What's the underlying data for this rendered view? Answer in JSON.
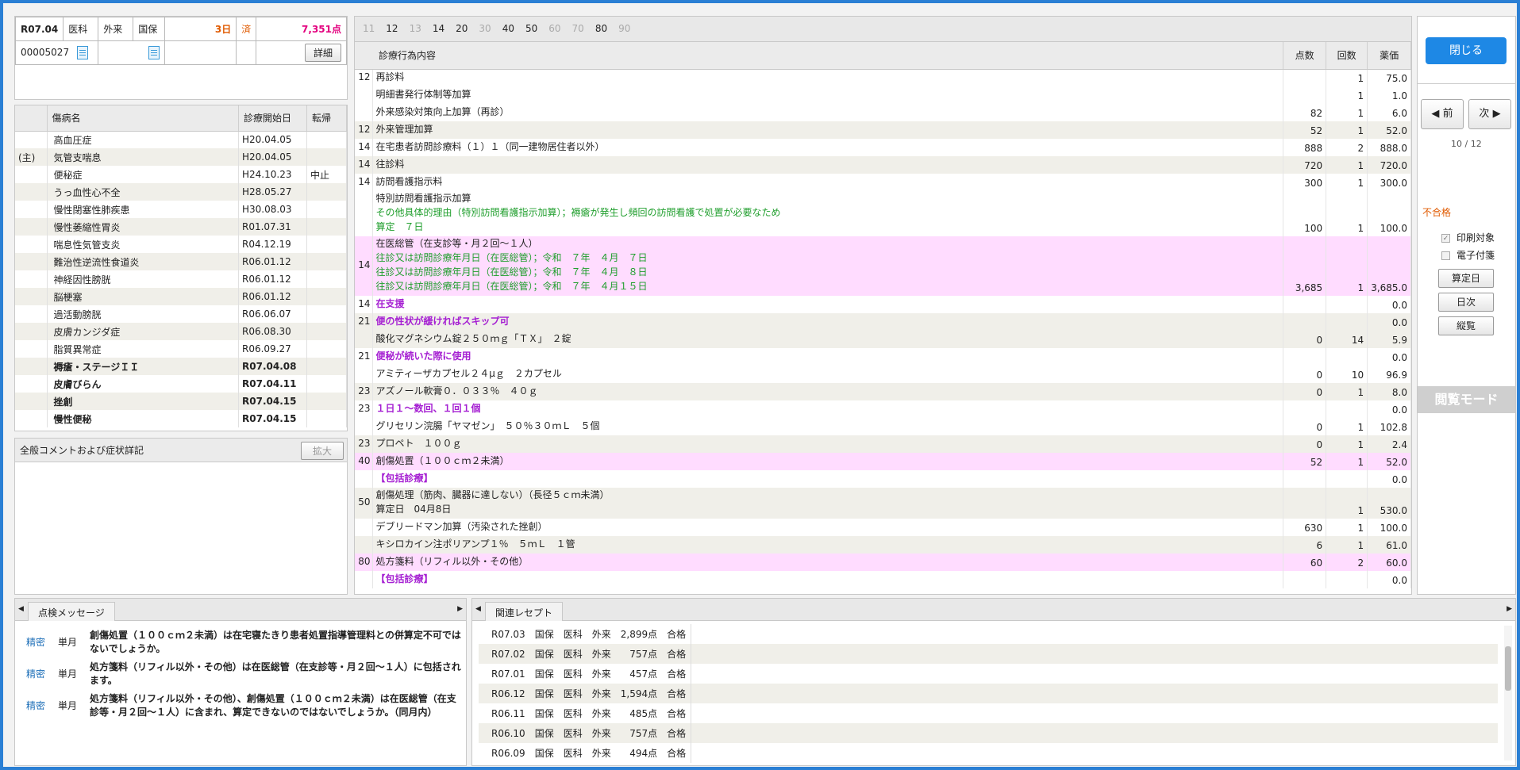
{
  "header": {
    "era": "R07.04",
    "dept": "医科",
    "visit": "外来",
    "ins": "国保",
    "days": "3日",
    "done": "済",
    "points": "7,351点",
    "patient_id": "00005027",
    "detail_btn": "詳細"
  },
  "disease": {
    "cols": [
      "傷病名",
      "診療開始日",
      "転帰"
    ],
    "rows": [
      {
        "mark": "",
        "name": "高血圧症",
        "date": "H20.04.05",
        "out": "",
        "bold": false
      },
      {
        "mark": "(主)",
        "name": "気管支喘息",
        "date": "H20.04.05",
        "out": "",
        "bold": false
      },
      {
        "mark": "",
        "name": "便秘症",
        "date": "H24.10.23",
        "out": "中止",
        "bold": false
      },
      {
        "mark": "",
        "name": "うっ血性心不全",
        "date": "H28.05.27",
        "out": "",
        "bold": false
      },
      {
        "mark": "",
        "name": "慢性閉塞性肺疾患",
        "date": "H30.08.03",
        "out": "",
        "bold": false
      },
      {
        "mark": "",
        "name": "慢性萎縮性胃炎",
        "date": "R01.07.31",
        "out": "",
        "bold": false
      },
      {
        "mark": "",
        "name": "喘息性気管支炎",
        "date": "R04.12.19",
        "out": "",
        "bold": false
      },
      {
        "mark": "",
        "name": "難治性逆流性食道炎",
        "date": "R06.01.12",
        "out": "",
        "bold": false
      },
      {
        "mark": "",
        "name": "神経因性膀胱",
        "date": "R06.01.12",
        "out": "",
        "bold": false
      },
      {
        "mark": "",
        "name": "脳梗塞",
        "date": "R06.01.12",
        "out": "",
        "bold": false
      },
      {
        "mark": "",
        "name": "過活動膀胱",
        "date": "R06.06.07",
        "out": "",
        "bold": false
      },
      {
        "mark": "",
        "name": "皮膚カンジダ症",
        "date": "R06.08.30",
        "out": "",
        "bold": false
      },
      {
        "mark": "",
        "name": "脂質異常症",
        "date": "R06.09.27",
        "out": "",
        "bold": false
      },
      {
        "mark": "",
        "name": "褥瘡・ステージＩＩ",
        "date": "R07.04.08",
        "out": "",
        "bold": true
      },
      {
        "mark": "",
        "name": "皮膚びらん",
        "date": "R07.04.11",
        "out": "",
        "bold": true
      },
      {
        "mark": "",
        "name": "挫創",
        "date": "R07.04.15",
        "out": "",
        "bold": true
      },
      {
        "mark": "",
        "name": "慢性便秘",
        "date": "R07.04.15",
        "out": "",
        "bold": true
      }
    ]
  },
  "comment": {
    "title": "全般コメントおよび症状詳記",
    "expand_btn": "拡大"
  },
  "tabs": [
    {
      "l": "11",
      "on": false
    },
    {
      "l": "12",
      "on": true
    },
    {
      "l": "13",
      "on": false
    },
    {
      "l": "14",
      "on": true
    },
    {
      "l": "20",
      "on": true
    },
    {
      "l": "30",
      "on": false
    },
    {
      "l": "40",
      "on": true
    },
    {
      "l": "50",
      "on": true
    },
    {
      "l": "60",
      "on": false
    },
    {
      "l": "70",
      "on": false
    },
    {
      "l": "80",
      "on": true
    },
    {
      "l": "90",
      "on": false
    }
  ],
  "main": {
    "cols": {
      "content": "診療行為内容",
      "points": "点数",
      "count": "回数",
      "price": "薬価"
    },
    "rows": [
      {
        "code": "12",
        "lines": [
          {
            "t": "再診料",
            "c": ""
          }
        ],
        "p": "",
        "n": "1",
        "v": "75.0",
        "bg": ""
      },
      {
        "code": "",
        "lines": [
          {
            "t": "明細書発行体制等加算",
            "c": ""
          }
        ],
        "p": "",
        "n": "1",
        "v": "1.0",
        "bg": ""
      },
      {
        "code": "",
        "lines": [
          {
            "t": "外来感染対策向上加算（再診）",
            "c": ""
          }
        ],
        "p": "82",
        "n": "1",
        "v": "6.0",
        "bg": ""
      },
      {
        "code": "12",
        "lines": [
          {
            "t": "外来管理加算",
            "c": ""
          }
        ],
        "p": "52",
        "n": "1",
        "v": "52.0",
        "bg": "alt"
      },
      {
        "code": "14",
        "lines": [
          {
            "t": "在宅患者訪問診療料（１）１（同一建物居住者以外）",
            "c": ""
          }
        ],
        "p": "888",
        "n": "2",
        "v": "888.0",
        "bg": ""
      },
      {
        "code": "14",
        "lines": [
          {
            "t": "往診料",
            "c": ""
          }
        ],
        "p": "720",
        "n": "1",
        "v": "720.0",
        "bg": "alt"
      },
      {
        "code": "14",
        "lines": [
          {
            "t": "訪問看護指示料",
            "c": ""
          }
        ],
        "p": "300",
        "n": "1",
        "v": "300.0",
        "bg": ""
      },
      {
        "code": "",
        "lines": [
          {
            "t": "特別訪問看護指示加算",
            "c": ""
          },
          {
            "t": "その他具体的理由（特別訪問看護指示加算）；褥瘡が発生し頻回の訪問看護で処置が必要なため",
            "c": "gr"
          },
          {
            "t": "算定　７日",
            "c": "gr"
          }
        ],
        "p": "100",
        "n": "1",
        "v": "100.0",
        "bg": ""
      },
      {
        "code": "14",
        "lines": [
          {
            "t": "在医総管（在支診等・月２回〜１人）",
            "c": ""
          },
          {
            "t": "往診又は訪問診療年月日（在医総管）；令和　７年　４月　７日",
            "c": "gr"
          },
          {
            "t": "往診又は訪問診療年月日（在医総管）；令和　７年　４月　８日",
            "c": "gr"
          },
          {
            "t": "往診又は訪問診療年月日（在医総管）；令和　７年　４月１５日",
            "c": "gr"
          }
        ],
        "p": "3,685",
        "n": "1",
        "v": "3,685.0",
        "bg": "pk"
      },
      {
        "code": "14",
        "lines": [
          {
            "t": "在支援",
            "c": "pu"
          }
        ],
        "p": "",
        "n": "",
        "v": "0.0",
        "bg": ""
      },
      {
        "code": "21",
        "lines": [
          {
            "t": "便の性状が緩ければスキップ可",
            "c": "pu"
          }
        ],
        "p": "",
        "n": "",
        "v": "0.0",
        "bg": "alt"
      },
      {
        "code": "",
        "lines": [
          {
            "t": "酸化マグネシウム錠２５０ｍｇ「ＴＸ」　２錠",
            "c": ""
          }
        ],
        "p": "0",
        "n": "14",
        "v": "5.9",
        "bg": "alt"
      },
      {
        "code": "21",
        "lines": [
          {
            "t": "便秘が続いた際に使用",
            "c": "pu"
          }
        ],
        "p": "",
        "n": "",
        "v": "0.0",
        "bg": ""
      },
      {
        "code": "",
        "lines": [
          {
            "t": "アミティーザカプセル２４μｇ　２カプセル",
            "c": ""
          }
        ],
        "p": "0",
        "n": "10",
        "v": "96.9",
        "bg": ""
      },
      {
        "code": "23",
        "lines": [
          {
            "t": "アズノール軟膏０．０３３％　４０ｇ",
            "c": ""
          }
        ],
        "p": "0",
        "n": "1",
        "v": "8.0",
        "bg": "alt"
      },
      {
        "code": "23",
        "lines": [
          {
            "t": "１日１〜数回、１回１個",
            "c": "pu"
          }
        ],
        "p": "",
        "n": "",
        "v": "0.0",
        "bg": ""
      },
      {
        "code": "",
        "lines": [
          {
            "t": "グリセリン浣腸「ヤマゼン」　５０％３０ｍＬ　５個",
            "c": ""
          }
        ],
        "p": "0",
        "n": "1",
        "v": "102.8",
        "bg": ""
      },
      {
        "code": "23",
        "lines": [
          {
            "t": "プロペト　１００ｇ",
            "c": ""
          }
        ],
        "p": "0",
        "n": "1",
        "v": "2.4",
        "bg": "alt"
      },
      {
        "code": "40",
        "lines": [
          {
            "t": "創傷処置（１００ｃｍ２未満）",
            "c": ""
          }
        ],
        "p": "52",
        "n": "1",
        "v": "52.0",
        "bg": "pk"
      },
      {
        "code": "",
        "lines": [
          {
            "t": "【包括診療】",
            "c": "pu"
          }
        ],
        "p": "",
        "n": "",
        "v": "0.0",
        "bg": ""
      },
      {
        "code": "50",
        "lines": [
          {
            "t": "創傷処理（筋肉、臓器に達しない）（長径５ｃｍ未満）",
            "c": ""
          },
          {
            "t": "算定日　04月8日",
            "c": ""
          }
        ],
        "p": "",
        "n": "1",
        "v": "530.0",
        "bg": "alt"
      },
      {
        "code": "",
        "lines": [
          {
            "t": "デブリードマン加算（汚染された挫創）",
            "c": ""
          }
        ],
        "p": "630",
        "n": "1",
        "v": "100.0",
        "bg": ""
      },
      {
        "code": "",
        "lines": [
          {
            "t": "キシロカイン注ポリアンプ１％　５ｍＬ　１管",
            "c": ""
          }
        ],
        "p": "6",
        "n": "1",
        "v": "61.0",
        "bg": "alt"
      },
      {
        "code": "80",
        "lines": [
          {
            "t": "処方箋料（リフィル以外・その他）",
            "c": ""
          }
        ],
        "p": "60",
        "n": "2",
        "v": "60.0",
        "bg": "pk"
      },
      {
        "code": "",
        "lines": [
          {
            "t": "【包括診療】",
            "c": "pu"
          }
        ],
        "p": "",
        "n": "",
        "v": "0.0",
        "bg": ""
      }
    ]
  },
  "right": {
    "close_btn": "閉じる",
    "prev_btn": "前",
    "next_btn": "次",
    "page": "10 / 12",
    "status": "不合格",
    "print_chk": "印刷対象",
    "attach_chk": "電子付箋",
    "calc_btn": "算定日",
    "daily_btn": "日次",
    "vertical_btn": "縦覧",
    "mode": "閲覧モード"
  },
  "check": {
    "tab": "点検メッセージ",
    "msgs": [
      {
        "kind": "精密",
        "period": "単月",
        "text": "創傷処置（１００ｃｍ２未満）は在宅寝たきり患者処置指導管理料との併算定不可ではないでしょうか。"
      },
      {
        "kind": "精密",
        "period": "単月",
        "text": "処方箋料（リフィル以外・その他）は在医総管（在支診等・月２回〜１人）に包括されます。"
      },
      {
        "kind": "精密",
        "period": "単月",
        "text": "処方箋料（リフィル以外・その他）、創傷処置（１００ｃｍ２未満）は在医総管（在支診等・月２回〜１人）に含まれ、算定できないのではないでしょうか。（同月内）"
      }
    ]
  },
  "related": {
    "tab": "関連レセプト",
    "rows": [
      {
        "ym": "R07.03",
        "ins": "国保",
        "dept": "医科",
        "visit": "外来",
        "amt": "2,899点",
        "res": "合格"
      },
      {
        "ym": "R07.02",
        "ins": "国保",
        "dept": "医科",
        "visit": "外来",
        "amt": "757点",
        "res": "合格"
      },
      {
        "ym": "R07.01",
        "ins": "国保",
        "dept": "医科",
        "visit": "外来",
        "amt": "457点",
        "res": "合格"
      },
      {
        "ym": "R06.12",
        "ins": "国保",
        "dept": "医科",
        "visit": "外来",
        "amt": "1,594点",
        "res": "合格"
      },
      {
        "ym": "R06.11",
        "ins": "国保",
        "dept": "医科",
        "visit": "外来",
        "amt": "485点",
        "res": "合格"
      },
      {
        "ym": "R06.10",
        "ins": "国保",
        "dept": "医科",
        "visit": "外来",
        "amt": "757点",
        "res": "合格"
      },
      {
        "ym": "R06.09",
        "ins": "国保",
        "dept": "医科",
        "visit": "外来",
        "amt": "494点",
        "res": "合格"
      }
    ]
  }
}
